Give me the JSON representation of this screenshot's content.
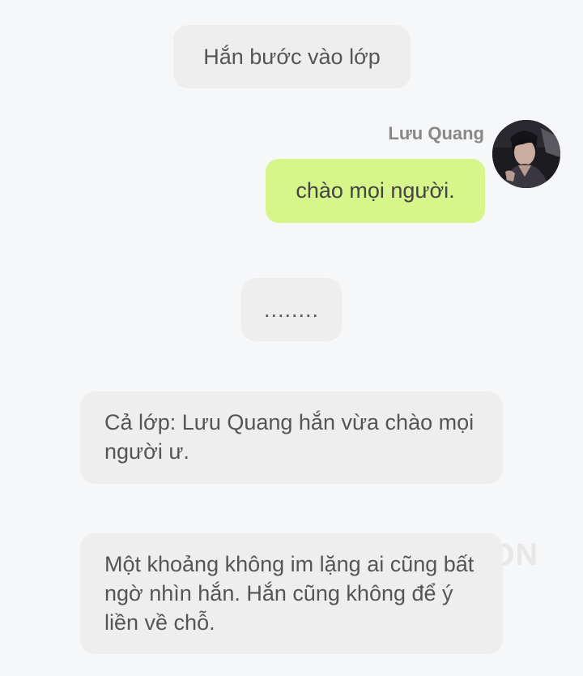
{
  "messages": {
    "narration_1": "Hắn bước vào lớp",
    "sender_name": "Lưu Quang",
    "own_message": "chào mọi người.",
    "narration_2": "........",
    "narration_3": "Cả lớp: Lưu Quang hắn vừa chào mọi người ư.",
    "narration_4": "Một khoảng không im lặng ai cũng bất ngờ nhìn hắn. Hắn cũng không để ý liền về chỗ."
  },
  "watermark": "ON",
  "colors": {
    "background": "#f6f7f9",
    "narration_bubble": "#eeeeee",
    "own_bubble": "#d6f58a",
    "text": "#555555"
  }
}
